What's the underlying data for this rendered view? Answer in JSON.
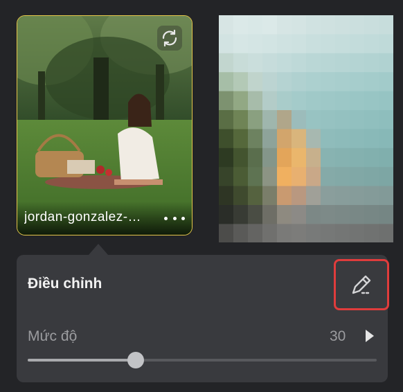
{
  "thumbnail": {
    "caption": "jordan-gonzalez-…",
    "refresh_icon": "refresh-icon",
    "more_icon": "more-horizontal-icon",
    "border_color": "#e6c64a"
  },
  "adjust_panel": {
    "title": "Điều chỉnh",
    "edit_icon": "edit-pen-icon",
    "highlight_color": "#e03c3c",
    "level_label": "Mức độ",
    "level_value": "30",
    "level_fraction": 0.31
  }
}
